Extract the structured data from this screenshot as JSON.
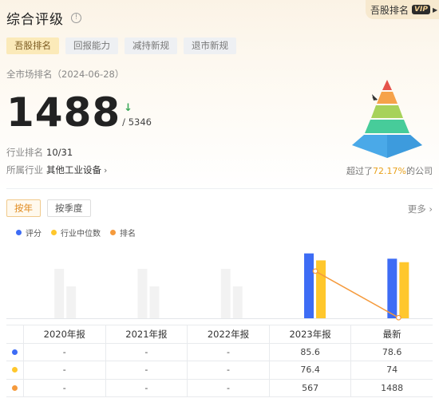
{
  "header": {
    "title": "综合评级",
    "info_icon": "info-icon"
  },
  "brand": {
    "label": "吾股排名",
    "badge": "VIP"
  },
  "tabs": [
    {
      "label": "吾股排名",
      "active": true
    },
    {
      "label": "回报能力",
      "active": false
    },
    {
      "label": "减持新规",
      "active": false
    },
    {
      "label": "退市新规",
      "active": false
    }
  ],
  "summary": {
    "subtitle": "全市场排名（2024-06-28）",
    "rank": "1488",
    "total": "/ 5346",
    "trend_icon": "down-arrow-icon",
    "industry_rank_label": "行业排名",
    "industry_rank": "10/31",
    "industry_label": "所属行业",
    "industry": "其他工业设备",
    "exceed_prefix": "超过了",
    "exceed_pct": "72.17%",
    "exceed_suffix": "的公司"
  },
  "period": {
    "options": [
      "按年",
      "按季度"
    ],
    "selected": "按年",
    "more": "更多"
  },
  "legend": [
    {
      "name": "评分",
      "color": "#3d6cf5"
    },
    {
      "name": "行业中位数",
      "color": "#ffc72c"
    },
    {
      "name": "排名",
      "color": "#f59a3c"
    }
  ],
  "chart_data": {
    "type": "bar",
    "categories": [
      "2020年报",
      "2021年报",
      "2022年报",
      "2023年报",
      "最新"
    ],
    "series": [
      {
        "name": "评分",
        "values": [
          null,
          null,
          null,
          85.6,
          78.6
        ],
        "color": "#3d6cf5"
      },
      {
        "name": "行业中位数",
        "values": [
          null,
          null,
          null,
          76.4,
          74
        ],
        "color": "#ffc72c"
      },
      {
        "name": "排名",
        "type": "line",
        "values": [
          null,
          null,
          null,
          567,
          1488
        ],
        "color": "#f59a3c"
      }
    ]
  },
  "table": {
    "headers": [
      "2020年报",
      "2021年报",
      "2022年报",
      "2023年报",
      "最新"
    ],
    "rows": [
      {
        "color": "#3d6cf5",
        "values": [
          "-",
          "-",
          "-",
          "85.6",
          "78.6"
        ]
      },
      {
        "color": "#ffc72c",
        "values": [
          "-",
          "-",
          "-",
          "76.4",
          "74"
        ]
      },
      {
        "color": "#f59a3c",
        "values": [
          "-",
          "-",
          "-",
          "567",
          "1488"
        ]
      }
    ]
  }
}
